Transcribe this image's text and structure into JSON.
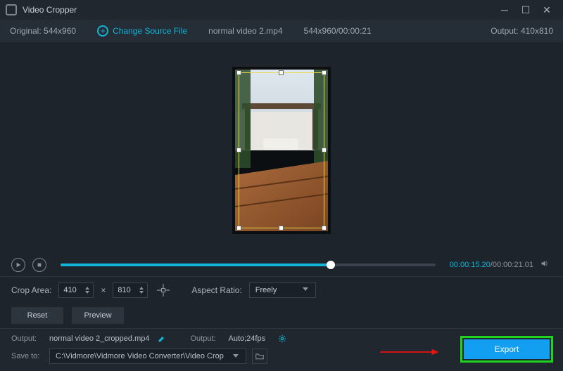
{
  "app": {
    "title": "Video Cropper"
  },
  "info": {
    "original_label": "Original:",
    "original_dims": "544x960",
    "change_source": "Change Source File",
    "filename": "normal video 2.mp4",
    "src_meta": "544x960/00:00:21",
    "output_label": "Output:",
    "output_dims": "410x810"
  },
  "playback": {
    "current": "00:00:15.20",
    "duration": "00:00:21.01",
    "progress_pct": 72
  },
  "crop": {
    "label": "Crop Area:",
    "width": "410",
    "height": "810",
    "times": "×",
    "aspect_label": "Aspect Ratio:",
    "aspect_value": "Freely"
  },
  "buttons": {
    "reset": "Reset",
    "preview": "Preview",
    "export": "Export"
  },
  "output": {
    "out_label": "Output:",
    "out_filename": "normal video 2_cropped.mp4",
    "out2_label": "Output:",
    "out2_value": "Auto;24fps",
    "save_label": "Save to:",
    "save_path": "C:\\Vidmore\\Vidmore Video Converter\\Video Crop"
  }
}
